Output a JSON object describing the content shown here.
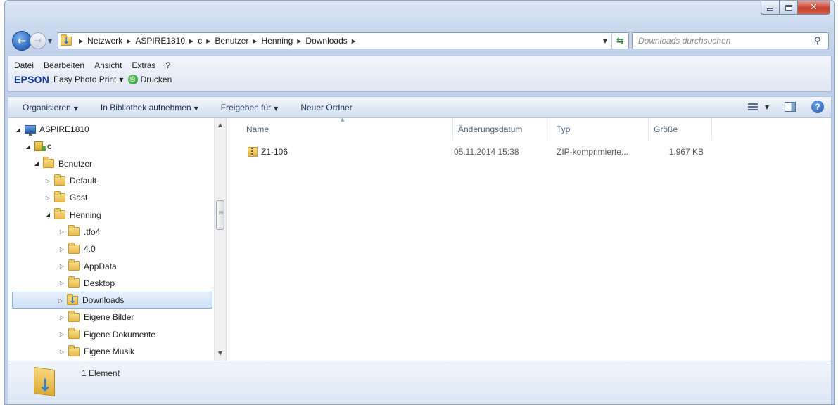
{
  "window": {
    "caption": {
      "minimize": "–",
      "maximize": "□",
      "close": "✕"
    }
  },
  "address": {
    "crumbs": [
      "Netzwerk",
      "ASPIRE1810",
      "c",
      "Benutzer",
      "Henning",
      "Downloads"
    ],
    "search_placeholder": "Downloads durchsuchen"
  },
  "menubar": {
    "items": [
      "Datei",
      "Bearbeiten",
      "Ansicht",
      "Extras",
      "?"
    ]
  },
  "epson": {
    "logo": "EPSON",
    "app_label": "Easy Photo Print",
    "print_label": "Drucken"
  },
  "commandbar": {
    "items": [
      "Organisieren",
      "In Bibliothek aufnehmen",
      "Freigeben für",
      "Neuer Ordner"
    ]
  },
  "tree": {
    "items": [
      {
        "label": "ASPIRE1810",
        "level": 0,
        "expander": "open",
        "icon": "computer-icon"
      },
      {
        "label": "c",
        "level": 1,
        "expander": "open",
        "icon": "drive-icon"
      },
      {
        "label": "Benutzer",
        "level": 2,
        "expander": "open",
        "icon": "folder-icon"
      },
      {
        "label": "Default",
        "level": 3,
        "expander": "closed",
        "icon": "folder-icon"
      },
      {
        "label": "Gast",
        "level": 3,
        "expander": "closed",
        "icon": "folder-icon"
      },
      {
        "label": "Henning",
        "level": 3,
        "expander": "open",
        "icon": "folder-icon"
      },
      {
        "label": ".tfo4",
        "level": 4,
        "expander": "closed",
        "icon": "folder-icon"
      },
      {
        "label": "4.0",
        "level": 4,
        "expander": "closed",
        "icon": "folder-icon"
      },
      {
        "label": "AppData",
        "level": 4,
        "expander": "closed",
        "icon": "folder-icon"
      },
      {
        "label": "Desktop",
        "level": 4,
        "expander": "closed",
        "icon": "desktop-folder-icon"
      },
      {
        "label": "Downloads",
        "level": 4,
        "expander": "closed",
        "icon": "downloads-folder-icon",
        "selected": true
      },
      {
        "label": "Eigene Bilder",
        "level": 4,
        "expander": "closed",
        "icon": "pictures-folder-icon"
      },
      {
        "label": "Eigene Dokumente",
        "level": 4,
        "expander": "closed",
        "icon": "documents-folder-icon"
      },
      {
        "label": "Eigene Musik",
        "level": 4,
        "expander": "closed",
        "icon": "music-folder-icon"
      }
    ]
  },
  "files": {
    "columns": [
      "Name",
      "Änderungsdatum",
      "Typ",
      "Größe"
    ],
    "rows": [
      {
        "name": "Z1-106",
        "date": "05.11.2014 15:38",
        "type": "ZIP-komprimierte...",
        "size": "1.967 KB",
        "icon": "zip-folder-icon"
      }
    ]
  },
  "details": {
    "count_text": "1 Element"
  }
}
